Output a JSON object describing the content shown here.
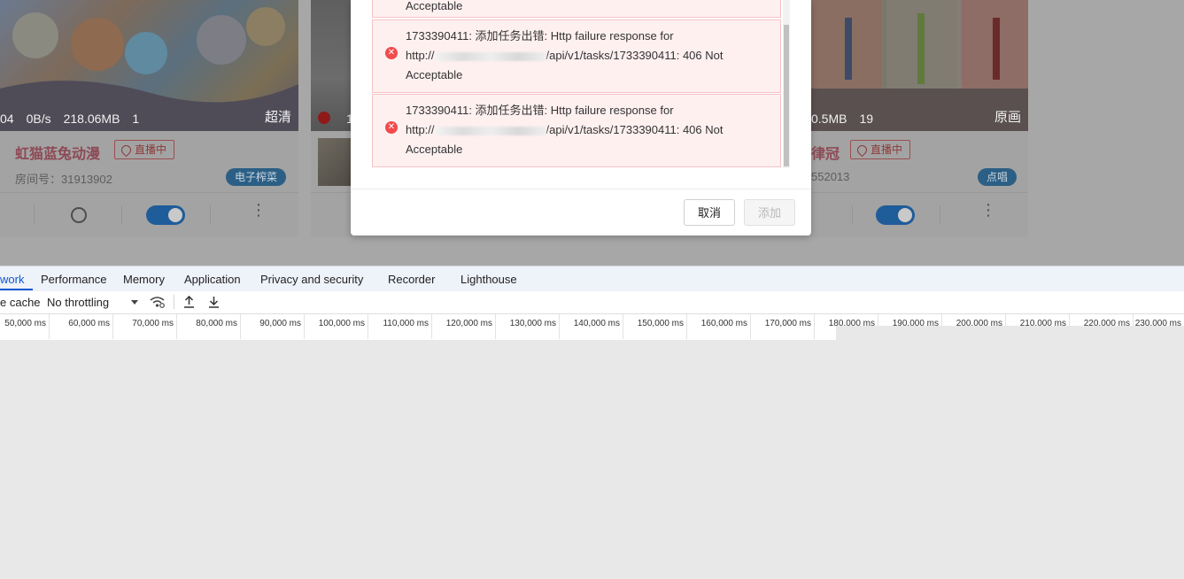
{
  "cards": [
    {
      "title": "虹猫蓝兔动漫",
      "live_badge": "直播中",
      "room_number": "房间号：31913902",
      "tag": "电子榨菜",
      "stats": [
        "04",
        "0B/s",
        "218.06MB",
        "1"
      ],
      "quality": "超清"
    },
    {
      "stats": [
        "1"
      ]
    },
    {
      "title": "律冠",
      "live_badge": "直播中",
      "room_number": "552013",
      "tag": "点唱",
      "stats": [
        "0.5MB",
        "19"
      ],
      "quality": "原画"
    }
  ],
  "dialog": {
    "messages": [
      {
        "line1": "",
        "url_prefix": "",
        "url_suffix": "",
        "line3": "Acceptable"
      },
      {
        "line1": "1733390411: 添加任务出错: Http failure response for",
        "url_prefix": "http://",
        "url_suffix": "/api/v1/tasks/1733390411: 406 Not",
        "line3": "Acceptable"
      },
      {
        "line1": "1733390411: 添加任务出错: Http failure response for",
        "url_prefix": "http://",
        "url_suffix": "/api/v1/tasks/1733390411: 406 Not",
        "line3": "Acceptable"
      }
    ],
    "cancel_label": "取消",
    "add_label": "添加"
  },
  "devtools": {
    "tabs": [
      "work",
      "Performance",
      "Memory",
      "Application",
      "Privacy and security",
      "Recorder",
      "Lighthouse"
    ],
    "active_tab": "work",
    "toolbar": {
      "cache_label": "e cache",
      "throttling": "No throttling"
    },
    "timeline_ticks": [
      "50,000 ms",
      "60,000 ms",
      "70,000 ms",
      "80,000 ms",
      "90,000 ms",
      "100,000 ms",
      "110,000 ms",
      "120,000 ms",
      "130,000 ms",
      "140,000 ms",
      "150,000 ms",
      "160,000 ms",
      "170,000 ms",
      "180,000 ms",
      "190,000 ms",
      "200,000 ms",
      "210,000 ms",
      "220,000 ms",
      "230,000 ms"
    ]
  },
  "colors": {
    "accent": "#0b57d0",
    "error": "#f04c4c",
    "error_bg": "#fff0f0",
    "overlay": "#a7a7a7"
  }
}
